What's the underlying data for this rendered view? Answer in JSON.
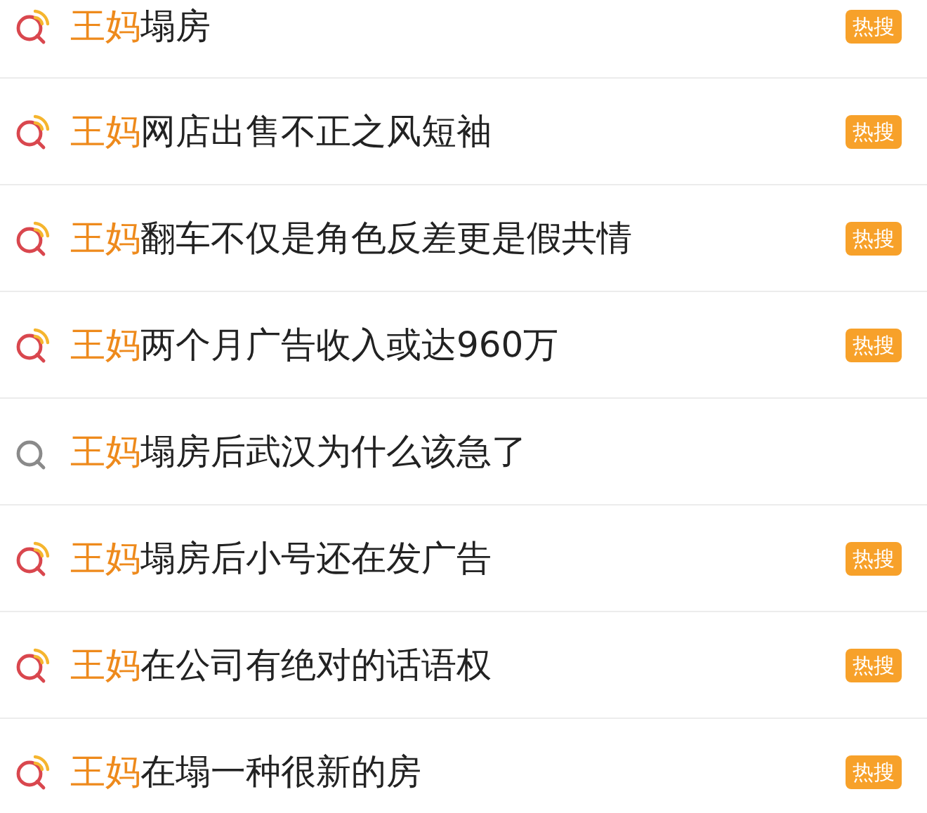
{
  "results": [
    {
      "keyword": "王妈",
      "rest": "塌房",
      "hot": true,
      "badge": "热搜"
    },
    {
      "keyword": "王妈",
      "rest": "网店出售不正之风短袖",
      "hot": true,
      "badge": "热搜"
    },
    {
      "keyword": "王妈",
      "rest": "翻车不仅是角色反差更是假共情",
      "hot": true,
      "badge": "热搜"
    },
    {
      "keyword": "王妈",
      "rest": "两个月广告收入或达960万",
      "hot": true,
      "badge": "热搜"
    },
    {
      "keyword": "王妈",
      "rest": "塌房后武汉为什么该急了",
      "hot": false
    },
    {
      "keyword": "王妈",
      "rest": "塌房后小号还在发广告",
      "hot": true,
      "badge": "热搜"
    },
    {
      "keyword": "王妈",
      "rest": "在公司有绝对的话语权",
      "hot": true,
      "badge": "热搜"
    },
    {
      "keyword": "王妈",
      "rest": "在塌一种很新的房",
      "hot": true,
      "badge": "热搜"
    }
  ]
}
